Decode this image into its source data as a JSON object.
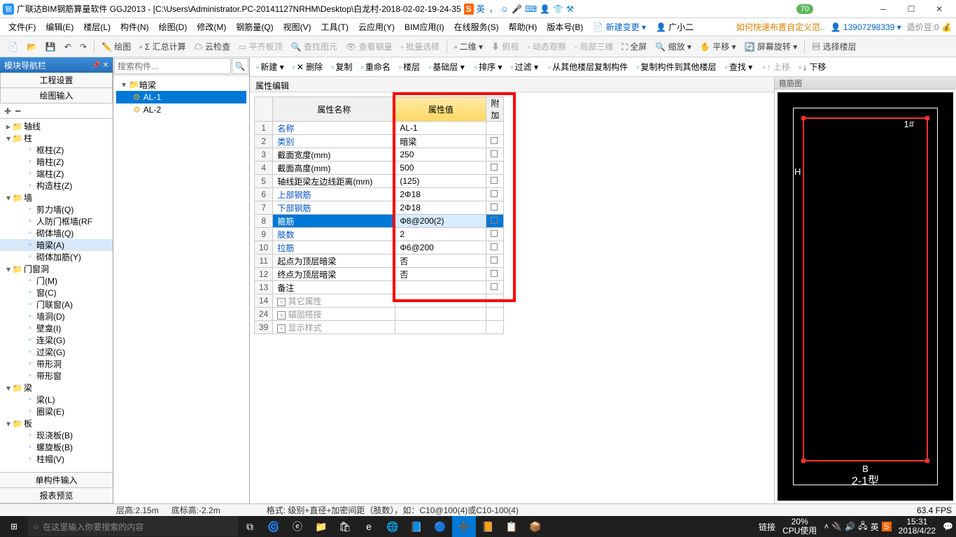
{
  "title": "广联达BIM钢筋算量软件 GGJ2013 - [C:\\Users\\Administrator.PC-20141127NRHM\\Desktop\\白龙村-2018-02-02-19-24-35",
  "ime": {
    "badge": "S",
    "mode": "英",
    "icons": [
      "，",
      "☺",
      "🎤",
      "⌨",
      "👤",
      "👕",
      "⚒"
    ]
  },
  "counter": "70",
  "menu": [
    "文件(F)",
    "编辑(E)",
    "楼层(L)",
    "构件(N)",
    "绘图(D)",
    "修改(M)",
    "钢筋量(Q)",
    "视图(V)",
    "工具(T)",
    "云应用(Y)",
    "BIM应用(I)",
    "在线服务(S)",
    "帮助(H)",
    "版本号(B)"
  ],
  "menu_right": {
    "newchange": "新建变更",
    "user": "广小二",
    "tip": "如何快速布置自定义范..",
    "account": "13907298339",
    "coin": "造价豆:0"
  },
  "toolbar1": [
    {
      "t": "",
      "k": "new"
    },
    {
      "t": "",
      "k": "open"
    },
    {
      "t": "",
      "k": "save"
    },
    {
      "t": "",
      "k": "undo"
    },
    {
      "t": "",
      "k": "redo"
    },
    {
      "sep": true
    },
    {
      "t": "绘图",
      "k": "draw"
    },
    {
      "t": "Σ 汇总计算",
      "k": "sum"
    },
    {
      "t": "云检查",
      "k": "cloud"
    },
    {
      "t": "平齐板顶",
      "k": "flat",
      "g": true
    },
    {
      "t": "查找图元",
      "k": "find",
      "g": true
    },
    {
      "t": "查看钢量",
      "k": "view",
      "g": true
    },
    {
      "t": "批量选择",
      "k": "batch",
      "g": true
    },
    {
      "sep": true
    },
    {
      "t": "二维 ▾",
      "k": "2d"
    },
    {
      "t": "俯视",
      "k": "top",
      "g": true
    },
    {
      "t": "动态观察",
      "k": "dyn",
      "g": true
    },
    {
      "t": "局部三维",
      "k": "3d",
      "g": true
    },
    {
      "t": "全屏",
      "k": "full"
    },
    {
      "t": "缩放 ▾",
      "k": "zoom"
    },
    {
      "t": "平移 ▾",
      "k": "pan"
    },
    {
      "t": "屏幕旋转 ▾",
      "k": "rot"
    },
    {
      "sep": true
    },
    {
      "t": "选择楼层",
      "k": "floor"
    }
  ],
  "leftpanel": {
    "hdr": "模块导航栏",
    "btns": [
      "工程设置",
      "绘图输入"
    ]
  },
  "tree": [
    {
      "lvl": 0,
      "arrow": ">",
      "icon": "folder",
      "label": "轴线"
    },
    {
      "lvl": 0,
      "arrow": "v",
      "icon": "folder",
      "label": "柱"
    },
    {
      "lvl": 1,
      "icon": "item",
      "label": "框柱(Z)"
    },
    {
      "lvl": 1,
      "icon": "item",
      "label": "暗柱(Z)"
    },
    {
      "lvl": 1,
      "icon": "item",
      "label": "端柱(Z)"
    },
    {
      "lvl": 1,
      "icon": "item",
      "label": "构造柱(Z)"
    },
    {
      "lvl": 0,
      "arrow": "v",
      "icon": "folder",
      "label": "墙"
    },
    {
      "lvl": 1,
      "icon": "item",
      "label": "剪力墙(Q)"
    },
    {
      "lvl": 1,
      "icon": "item",
      "label": "人防门框墙(RF"
    },
    {
      "lvl": 1,
      "icon": "item",
      "label": "砌体墙(Q)"
    },
    {
      "lvl": 1,
      "icon": "item",
      "label": "暗梁(A)",
      "sel": true
    },
    {
      "lvl": 1,
      "icon": "item",
      "label": "砌体加筋(Y)"
    },
    {
      "lvl": 0,
      "arrow": "v",
      "icon": "folder",
      "label": "门窗洞"
    },
    {
      "lvl": 1,
      "icon": "item",
      "label": "门(M)"
    },
    {
      "lvl": 1,
      "icon": "item",
      "label": "窗(C)"
    },
    {
      "lvl": 1,
      "icon": "item",
      "label": "门联窗(A)"
    },
    {
      "lvl": 1,
      "icon": "item",
      "label": "墙洞(D)"
    },
    {
      "lvl": 1,
      "icon": "item",
      "label": "壁龛(I)"
    },
    {
      "lvl": 1,
      "icon": "item",
      "label": "连梁(G)"
    },
    {
      "lvl": 1,
      "icon": "item",
      "label": "过梁(G)"
    },
    {
      "lvl": 1,
      "icon": "item",
      "label": "带形洞"
    },
    {
      "lvl": 1,
      "icon": "item",
      "label": "带形窗"
    },
    {
      "lvl": 0,
      "arrow": "v",
      "icon": "folder",
      "label": "梁"
    },
    {
      "lvl": 1,
      "icon": "item",
      "label": "梁(L)"
    },
    {
      "lvl": 1,
      "icon": "item",
      "label": "圈梁(E)"
    },
    {
      "lvl": 0,
      "arrow": "v",
      "icon": "folder",
      "label": "板"
    },
    {
      "lvl": 1,
      "icon": "item",
      "label": "现浇板(B)"
    },
    {
      "lvl": 1,
      "icon": "item",
      "label": "螺旋板(B)"
    },
    {
      "lvl": 1,
      "icon": "item",
      "label": "柱帽(V)"
    }
  ],
  "lefttabs": [
    "单构件输入",
    "报表预览"
  ],
  "mid": {
    "search_ph": "搜索构件...",
    "root": "暗梁",
    "items": [
      "AL-1",
      "AL-2"
    ],
    "sel": 0
  },
  "content_toolbar": [
    {
      "t": "新建 ▾"
    },
    {
      "t": "✕ 删除"
    },
    {
      "t": "复制"
    },
    {
      "t": "重命名"
    },
    {
      "t": "楼层"
    },
    {
      "t": "基础层 ▾"
    },
    {
      "sep": true
    },
    {
      "t": "排序 ▾"
    },
    {
      "t": "过滤 ▾"
    },
    {
      "sep": true
    },
    {
      "t": "从其他楼层复制构件"
    },
    {
      "t": "复制构件到其他楼层"
    },
    {
      "t": "查找 ▾"
    },
    {
      "sep": true
    },
    {
      "t": "↑ 上移",
      "g": true
    },
    {
      "t": "↓ 下移"
    }
  ],
  "prop_hdr": "属性编辑",
  "prop_cols": {
    "name": "属性名称",
    "val": "属性值",
    "add": "附加"
  },
  "props": [
    {
      "n": "1",
      "name": "名称",
      "val": "AL-1",
      "link": true
    },
    {
      "n": "2",
      "name": "类别",
      "val": "暗梁",
      "link": true
    },
    {
      "n": "3",
      "name": "截面宽度(mm)",
      "val": "250"
    },
    {
      "n": "4",
      "name": "截面高度(mm)",
      "val": "500"
    },
    {
      "n": "5",
      "name": "轴线距梁左边线距离(mm)",
      "val": "(125)"
    },
    {
      "n": "6",
      "name": "上部钢筋",
      "val": "2Φ18",
      "link": true
    },
    {
      "n": "7",
      "name": "下部钢筋",
      "val": "2Φ18",
      "link": true
    },
    {
      "n": "8",
      "name": "箍筋",
      "val": "Φ8@200(2)",
      "link": true,
      "sel": true
    },
    {
      "n": "9",
      "name": "肢数",
      "val": "2",
      "link": true
    },
    {
      "n": "10",
      "name": "拉筋",
      "val": "Φ6@200",
      "link": true
    },
    {
      "n": "11",
      "name": "起点为顶层暗梁",
      "val": "否"
    },
    {
      "n": "12",
      "name": "终点为顶层暗梁",
      "val": "否"
    },
    {
      "n": "13",
      "name": "备注",
      "val": ""
    },
    {
      "n": "14",
      "name": "其它属性",
      "val": "",
      "plus": true,
      "gray": true
    },
    {
      "n": "24",
      "name": "锚固搭接",
      "val": "",
      "plus": true,
      "gray": true
    },
    {
      "n": "39",
      "name": "显示样式",
      "val": "",
      "plus": true,
      "gray": true
    }
  ],
  "preview": {
    "hdr": "箍筋图",
    "label1": "1#",
    "labelH": "H",
    "labelB": "B",
    "label2": "2-1型"
  },
  "status": {
    "lg": "层高:2.15m",
    "dbg": "底标高:-2.2m",
    "fmt": "格式: 级别+直径+加密间距（肢数），如：C10@100(4)或C10-100(4)",
    "fps": "63.4 FPS"
  },
  "taskbar": {
    "search": "在这里输入你要搜索的内容",
    "link": "链接",
    "cpu1": "20%",
    "cpu2": "CPU使用",
    "time": "15:31",
    "date": "2018/4/22"
  }
}
